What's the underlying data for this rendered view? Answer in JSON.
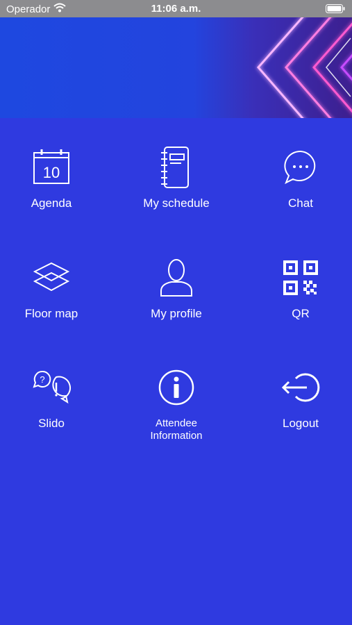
{
  "status_bar": {
    "carrier": "Operador",
    "time": "11:06 a.m."
  },
  "menu": {
    "agenda": {
      "label": "Agenda",
      "calendar_day": "10"
    },
    "my_schedule": {
      "label": "My schedule"
    },
    "chat": {
      "label": "Chat"
    },
    "floor_map": {
      "label": "Floor map"
    },
    "my_profile": {
      "label": "My profile"
    },
    "qr": {
      "label": "QR"
    },
    "slido": {
      "label": "Slido"
    },
    "attendee_information": {
      "label_line1": "Attendee",
      "label_line2": "Information"
    },
    "logout": {
      "label": "Logout"
    }
  },
  "colors": {
    "background": "#2f3ae0",
    "status_bar": "#8c8c8f",
    "banner_accent_pink": "#ff6ad5",
    "banner_accent_purple": "#b23cff"
  }
}
